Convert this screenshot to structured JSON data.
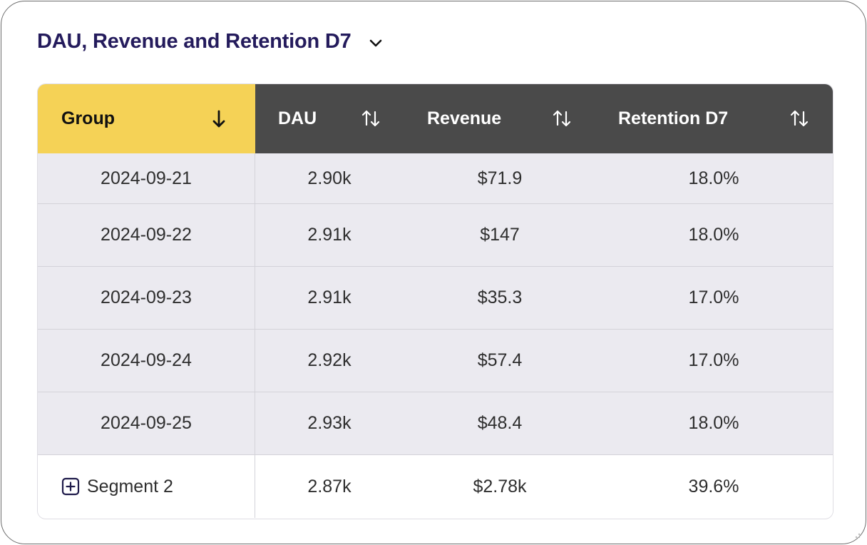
{
  "header": {
    "title": "DAU, Revenue and Retention D7",
    "dropdown_icon": "chevron-down-icon"
  },
  "columns": {
    "group": "Group",
    "dau": "DAU",
    "revenue": "Revenue",
    "retention": "Retention D7"
  },
  "sort": {
    "active_column": "Group",
    "active_icon": "arrow-down-icon",
    "inactive_icon": "sort-up-down-icon"
  },
  "rows": [
    {
      "group": "2024-09-21",
      "dau": "2.90k",
      "revenue": "$71.9",
      "retention": "18.0%"
    },
    {
      "group": "2024-09-22",
      "dau": "2.91k",
      "revenue": "$147",
      "retention": "18.0%"
    },
    {
      "group": "2024-09-23",
      "dau": "2.91k",
      "revenue": "$35.3",
      "retention": "17.0%"
    },
    {
      "group": "2024-09-24",
      "dau": "2.92k",
      "revenue": "$57.4",
      "retention": "17.0%"
    },
    {
      "group": "2024-09-25",
      "dau": "2.93k",
      "revenue": "$48.4",
      "retention": "18.0%"
    }
  ],
  "summary": {
    "group": "Segment 2",
    "dau": "2.87k",
    "revenue": "$2.78k",
    "retention": "39.6%",
    "icon": "expand-plus-icon"
  },
  "colors": {
    "header_active": "#f5d256",
    "header_dark": "#4a4a4a",
    "row_bg": "#ebeaf0",
    "title": "#241b5c"
  }
}
